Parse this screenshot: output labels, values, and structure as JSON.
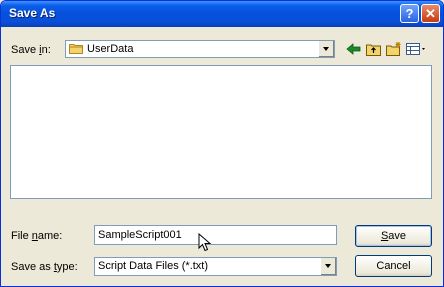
{
  "window": {
    "title": "Save As",
    "help_glyph": "?",
    "close_glyph": "✕"
  },
  "save_in": {
    "label_pre": "Save ",
    "label_accel": "i",
    "label_post": "n:",
    "value": "UserData"
  },
  "toolbar": {
    "icons": [
      "back-arrow-icon",
      "up-one-level-icon",
      "create-new-folder-icon",
      "view-menu-icon"
    ]
  },
  "file_name": {
    "label_pre": "File ",
    "label_accel": "n",
    "label_post": "ame:",
    "value": "SampleScript001"
  },
  "save_as_type": {
    "label_pre": "Save as ",
    "label_accel": "t",
    "label_post": "ype:",
    "value": "Script Data Files (*.txt)"
  },
  "buttons": {
    "save_accel": "S",
    "save_rest": "ave",
    "cancel": "Cancel"
  },
  "colors": {
    "titlebar": "#0550dd",
    "face": "#ece9d8",
    "field_border": "#7f9db9"
  }
}
